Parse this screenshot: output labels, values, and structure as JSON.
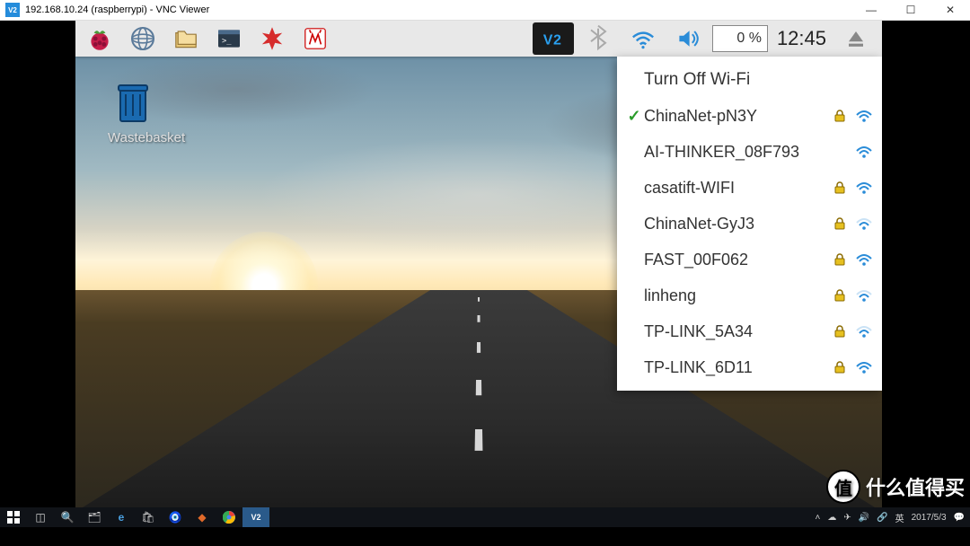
{
  "window": {
    "title": "192.168.10.24 (raspberrypi) - VNC Viewer"
  },
  "pi_panel": {
    "launchers": [
      "raspberry-menu",
      "web-browser",
      "file-manager",
      "terminal",
      "mathematica",
      "wolfram"
    ],
    "tray": {
      "vnc": "VNC",
      "cpu_text": "0 %",
      "clock": "12:45"
    }
  },
  "desktop": {
    "trash_label": "Wastebasket"
  },
  "wifi_menu": {
    "header": "Turn Off Wi-Fi",
    "networks": [
      {
        "name": "ChinaNet-pN3Y",
        "connected": true,
        "secured": true,
        "signal": "strong"
      },
      {
        "name": "AI-THINKER_08F793",
        "connected": false,
        "secured": false,
        "signal": "strong"
      },
      {
        "name": "casatift-WIFI",
        "connected": false,
        "secured": true,
        "signal": "strong"
      },
      {
        "name": "ChinaNet-GyJ3",
        "connected": false,
        "secured": true,
        "signal": "weak"
      },
      {
        "name": "FAST_00F062",
        "connected": false,
        "secured": true,
        "signal": "strong"
      },
      {
        "name": "linheng",
        "connected": false,
        "secured": true,
        "signal": "weak"
      },
      {
        "name": "TP-LINK_5A34",
        "connected": false,
        "secured": true,
        "signal": "weak"
      },
      {
        "name": "TP-LINK_6D11",
        "connected": false,
        "secured": true,
        "signal": "strong"
      }
    ]
  },
  "host_taskbar": {
    "items": [
      "start",
      "task-view",
      "search",
      "file-explorer",
      "edge",
      "store",
      "settings-app",
      "colorful-app",
      "chrome",
      "vnc-viewer"
    ],
    "tray_icons": [
      "up",
      "onedrive",
      "network",
      "ime",
      "volume",
      "wifi",
      "telegram",
      "input-cn"
    ],
    "ime_text": "英",
    "date": "2017/5/3"
  },
  "watermark": {
    "text": "什么值得买",
    "badge": "值"
  }
}
